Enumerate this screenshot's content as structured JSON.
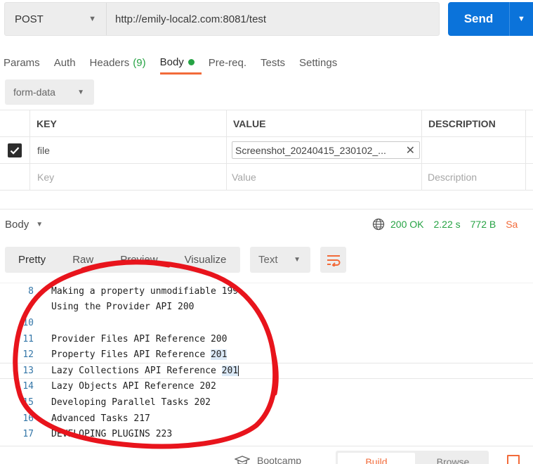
{
  "request": {
    "method": "POST",
    "url": "http://emily-local2.com:8081/test",
    "send_label": "Send"
  },
  "tabs": [
    {
      "label": "Params"
    },
    {
      "label": "Auth"
    },
    {
      "label": "Headers",
      "count": "(9)"
    },
    {
      "label": "Body"
    },
    {
      "label": "Pre-req."
    },
    {
      "label": "Tests"
    },
    {
      "label": "Settings"
    }
  ],
  "body_type": "form-data",
  "params_table": {
    "headers": [
      "KEY",
      "VALUE",
      "DESCRIPTION"
    ],
    "row": {
      "key": "file",
      "value": "Screenshot_20240415_230102_...",
      "description": ""
    },
    "placeholders": {
      "key": "Key",
      "value": "Value",
      "description": "Description"
    }
  },
  "response": {
    "title": "Body",
    "status": "200 OK",
    "time": "2.22 s",
    "size": "772 B",
    "save": "Sa"
  },
  "view_tabs": [
    "Pretty",
    "Raw",
    "Preview",
    "Visualize"
  ],
  "format": "Text",
  "code_lines": [
    {
      "num": "8",
      "text": "Making a property unmodifiable 199"
    },
    {
      "num": "",
      "text": "Using the Provider API 200"
    },
    {
      "num": "10",
      "text": ""
    },
    {
      "num": "11",
      "text": "Provider Files API Reference 200"
    },
    {
      "num": "12",
      "text": "Property Files API Reference ",
      "hl": "201"
    },
    {
      "num": "13",
      "text": "Lazy Collections API Reference ",
      "hl": "201"
    },
    {
      "num": "14",
      "text": "Lazy Objects API Reference 202"
    },
    {
      "num": "15",
      "text": "Developing Parallel Tasks 202"
    },
    {
      "num": "16",
      "text": "Advanced Tasks 217"
    },
    {
      "num": "17",
      "text": "DEVELOPING PLUGINS 223"
    }
  ],
  "footer": {
    "bootcamp": "Bootcamp",
    "build": "Build",
    "browse": "Browse"
  },
  "colors": {
    "accent": "#f26b3a",
    "primary": "#0b73da",
    "success": "#26a344",
    "annotation": "#e8141c"
  },
  "icons": [
    "chevron-down-icon",
    "check-icon",
    "close-icon",
    "globe-icon",
    "wrap-lines-icon",
    "bootcamp-icon",
    "panel-icon"
  ]
}
